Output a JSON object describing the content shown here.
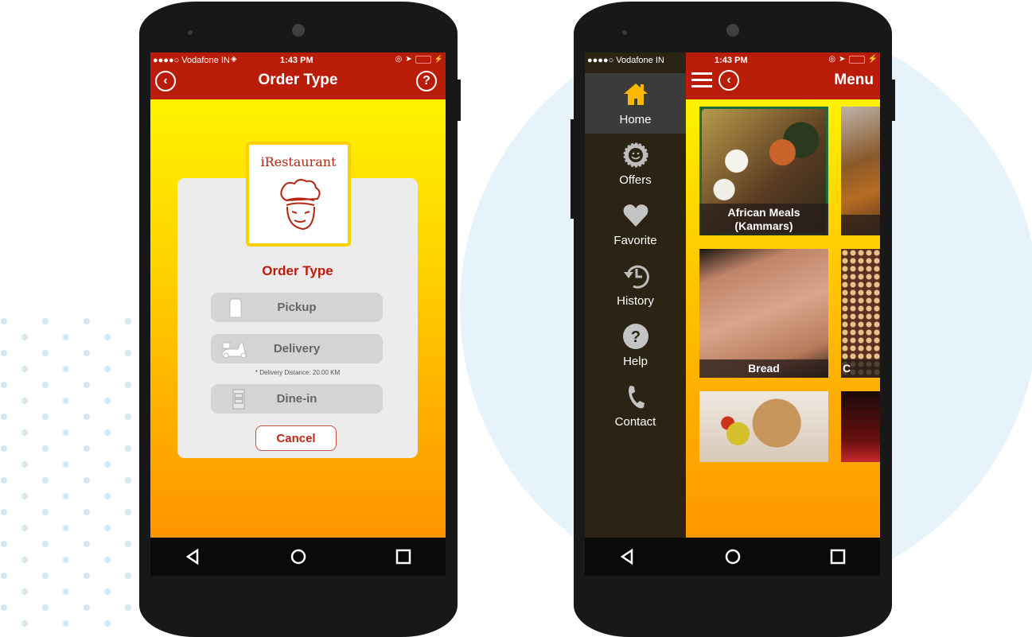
{
  "status_bar": {
    "carrier": "●●●●○ Vodafone IN",
    "time": "1:43 PM"
  },
  "order_screen": {
    "header_title": "Order Type",
    "back_icon": "chevron-left-circle",
    "help_icon": "question-circle",
    "help_label": "?",
    "logo_text": "iRestaurant",
    "dialog_title": "Order Type",
    "options": [
      {
        "label": "Pickup",
        "icon": "shopping-bag-icon"
      },
      {
        "label": "Delivery",
        "icon": "scooter-icon"
      },
      {
        "label": "Dine-in",
        "icon": "menu-card-icon"
      }
    ],
    "delivery_note": "* Delivery Distance: 20.00 KM",
    "cancel_label": "Cancel"
  },
  "menu_screen": {
    "header_title": "Menu",
    "sidebar": [
      {
        "label": "Home",
        "icon": "home-icon",
        "active": true
      },
      {
        "label": "Offers",
        "icon": "offers-badge-icon",
        "active": false
      },
      {
        "label": "Favorite",
        "icon": "heart-icon",
        "active": false
      },
      {
        "label": "History",
        "icon": "history-icon",
        "active": false
      },
      {
        "label": "Help",
        "icon": "help-icon",
        "active": false
      },
      {
        "label": "Contact",
        "icon": "phone-icon",
        "active": false
      }
    ],
    "tiles": [
      {
        "caption": "African Meals (Kammars)"
      },
      {
        "caption": ""
      },
      {
        "caption": "Bread"
      },
      {
        "caption": "C"
      },
      {
        "caption": ""
      },
      {
        "caption": ""
      }
    ]
  },
  "colors": {
    "header_red": "#b91d0a",
    "accent_yellow": "#fff200",
    "accent_orange": "#ff9500",
    "sidebar_dark": "#2b2414",
    "home_icon": "#fcb900"
  }
}
